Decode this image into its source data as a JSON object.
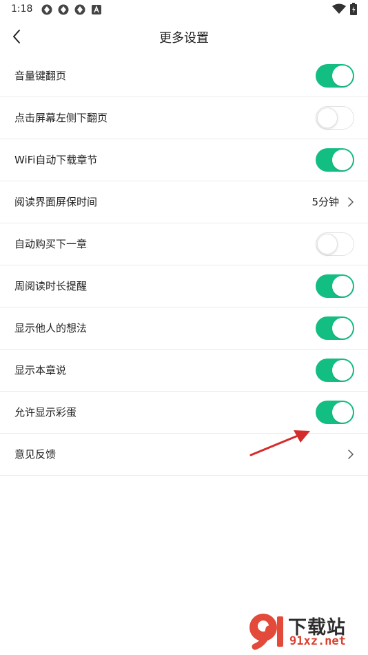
{
  "status_bar": {
    "time": "1:18",
    "left_icons": [
      "sync-icon",
      "sync-icon",
      "sync-icon",
      "a-badge-icon"
    ],
    "right_icons": [
      "wifi-icon",
      "battery-charging-icon"
    ]
  },
  "nav": {
    "title": "更多设置",
    "back_icon": "chevron-left-icon"
  },
  "settings": [
    {
      "label": "音量键翻页",
      "type": "toggle",
      "on": true
    },
    {
      "label": "点击屏幕左侧下翻页",
      "type": "toggle",
      "on": false
    },
    {
      "label": "WiFi自动下载章节",
      "type": "toggle",
      "on": true
    },
    {
      "label": "阅读界面屏保时间",
      "type": "value",
      "value": "5分钟"
    },
    {
      "label": "自动购买下一章",
      "type": "toggle",
      "on": false
    },
    {
      "label": "周阅读时长提醒",
      "type": "toggle",
      "on": true
    },
    {
      "label": "显示他人的想法",
      "type": "toggle",
      "on": true
    },
    {
      "label": "显示本章说",
      "type": "toggle",
      "on": true
    },
    {
      "label": "允许显示彩蛋",
      "type": "toggle",
      "on": true
    },
    {
      "label": "意见反馈",
      "type": "link"
    }
  ],
  "colors": {
    "toggle_on": "#13be82",
    "arrow": "#d62b2b"
  },
  "watermark": {
    "logo_text": "9",
    "name": "下载站",
    "url": "91xz.net"
  }
}
